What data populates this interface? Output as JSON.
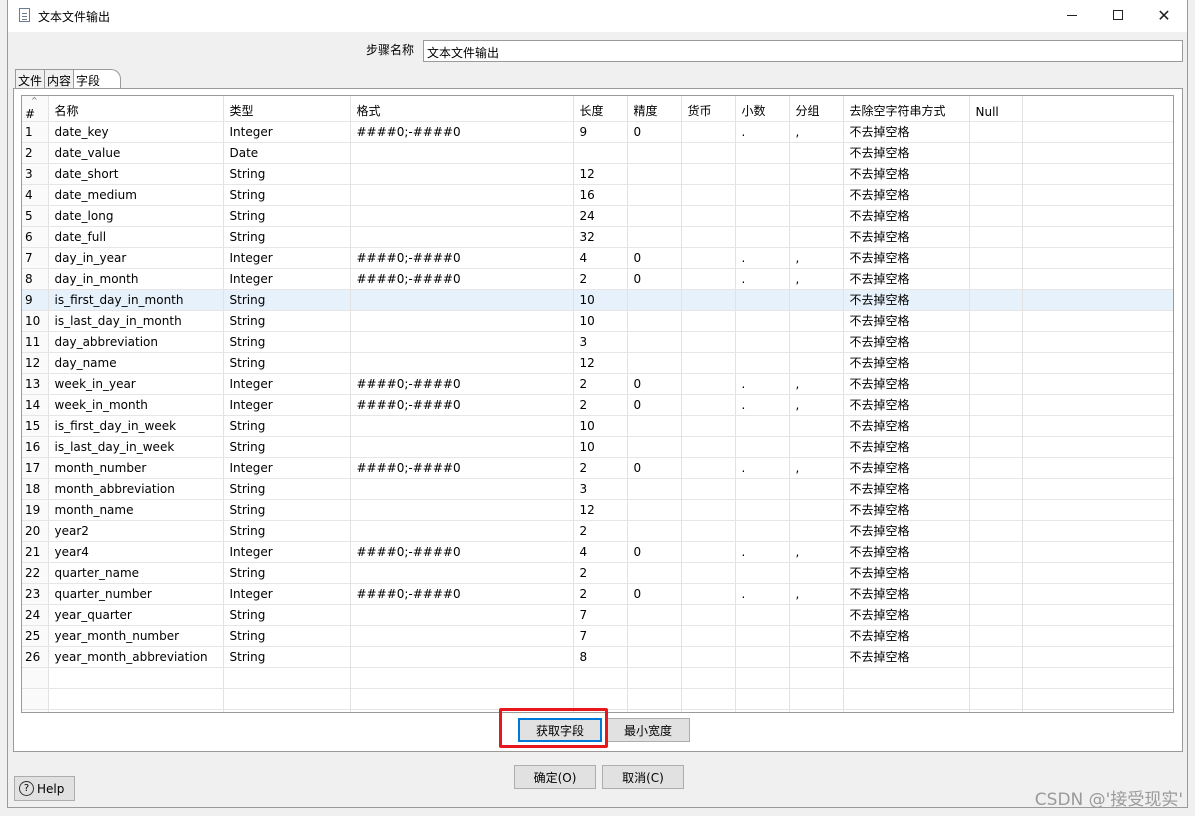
{
  "window": {
    "title": "文本文件输出"
  },
  "step": {
    "label": "步骤名称",
    "value": "文本文件输出"
  },
  "tabs": [
    {
      "label": "文件"
    },
    {
      "label": "内容"
    },
    {
      "label": "字段"
    }
  ],
  "grid": {
    "columns": [
      "#",
      "名称",
      "类型",
      "格式",
      "长度",
      "精度",
      "货币",
      "小数",
      "分组",
      "去除空字符串方式",
      "Null"
    ],
    "selected_row": 9,
    "rows": [
      [
        "1",
        "date_key",
        "Integer",
        "####0;-####0",
        "9",
        "0",
        "",
        ".",
        ",",
        "不去掉空格",
        ""
      ],
      [
        "2",
        "date_value",
        "Date",
        "",
        "",
        "",
        "",
        "",
        "",
        "不去掉空格",
        ""
      ],
      [
        "3",
        "date_short",
        "String",
        "",
        "12",
        "",
        "",
        "",
        "",
        "不去掉空格",
        ""
      ],
      [
        "4",
        "date_medium",
        "String",
        "",
        "16",
        "",
        "",
        "",
        "",
        "不去掉空格",
        ""
      ],
      [
        "5",
        "date_long",
        "String",
        "",
        "24",
        "",
        "",
        "",
        "",
        "不去掉空格",
        ""
      ],
      [
        "6",
        "date_full",
        "String",
        "",
        "32",
        "",
        "",
        "",
        "",
        "不去掉空格",
        ""
      ],
      [
        "7",
        "day_in_year",
        "Integer",
        "####0;-####0",
        "4",
        "0",
        "",
        ".",
        ",",
        "不去掉空格",
        ""
      ],
      [
        "8",
        "day_in_month",
        "Integer",
        "####0;-####0",
        "2",
        "0",
        "",
        ".",
        ",",
        "不去掉空格",
        ""
      ],
      [
        "9",
        "is_first_day_in_month",
        "String",
        "",
        "10",
        "",
        "",
        "",
        "",
        "不去掉空格",
        ""
      ],
      [
        "10",
        "is_last_day_in_month",
        "String",
        "",
        "10",
        "",
        "",
        "",
        "",
        "不去掉空格",
        ""
      ],
      [
        "11",
        "day_abbreviation",
        "String",
        "",
        "3",
        "",
        "",
        "",
        "",
        "不去掉空格",
        ""
      ],
      [
        "12",
        "day_name",
        "String",
        "",
        "12",
        "",
        "",
        "",
        "",
        "不去掉空格",
        ""
      ],
      [
        "13",
        "week_in_year",
        "Integer",
        "####0;-####0",
        "2",
        "0",
        "",
        ".",
        ",",
        "不去掉空格",
        ""
      ],
      [
        "14",
        "week_in_month",
        "Integer",
        "####0;-####0",
        "2",
        "0",
        "",
        ".",
        ",",
        "不去掉空格",
        ""
      ],
      [
        "15",
        "is_first_day_in_week",
        "String",
        "",
        "10",
        "",
        "",
        "",
        "",
        "不去掉空格",
        ""
      ],
      [
        "16",
        "is_last_day_in_week",
        "String",
        "",
        "10",
        "",
        "",
        "",
        "",
        "不去掉空格",
        ""
      ],
      [
        "17",
        "month_number",
        "Integer",
        "####0;-####0",
        "2",
        "0",
        "",
        ".",
        ",",
        "不去掉空格",
        ""
      ],
      [
        "18",
        "month_abbreviation",
        "String",
        "",
        "3",
        "",
        "",
        "",
        "",
        "不去掉空格",
        ""
      ],
      [
        "19",
        "month_name",
        "String",
        "",
        "12",
        "",
        "",
        "",
        "",
        "不去掉空格",
        ""
      ],
      [
        "20",
        "year2",
        "String",
        "",
        "2",
        "",
        "",
        "",
        "",
        "不去掉空格",
        ""
      ],
      [
        "21",
        "year4",
        "Integer",
        "####0;-####0",
        "4",
        "0",
        "",
        ".",
        ",",
        "不去掉空格",
        ""
      ],
      [
        "22",
        "quarter_name",
        "String",
        "",
        "2",
        "",
        "",
        "",
        "",
        "不去掉空格",
        ""
      ],
      [
        "23",
        "quarter_number",
        "Integer",
        "####0;-####0",
        "2",
        "0",
        "",
        ".",
        ",",
        "不去掉空格",
        ""
      ],
      [
        "24",
        "year_quarter",
        "String",
        "",
        "7",
        "",
        "",
        "",
        "",
        "不去掉空格",
        ""
      ],
      [
        "25",
        "year_month_number",
        "String",
        "",
        "7",
        "",
        "",
        "",
        "",
        "不去掉空格",
        ""
      ],
      [
        "26",
        "year_month_abbreviation",
        "String",
        "",
        "8",
        "",
        "",
        "",
        "",
        "不去掉空格",
        ""
      ]
    ]
  },
  "buttons": {
    "get_fields": "获取字段",
    "min_width": "最小宽度",
    "ok": "确定(O)",
    "cancel": "取消(C)",
    "help": "Help"
  },
  "watermark": "CSDN @'接受现实'",
  "colors": {
    "highlight": "#e8161d",
    "selected_row": "#e6f1fb"
  }
}
